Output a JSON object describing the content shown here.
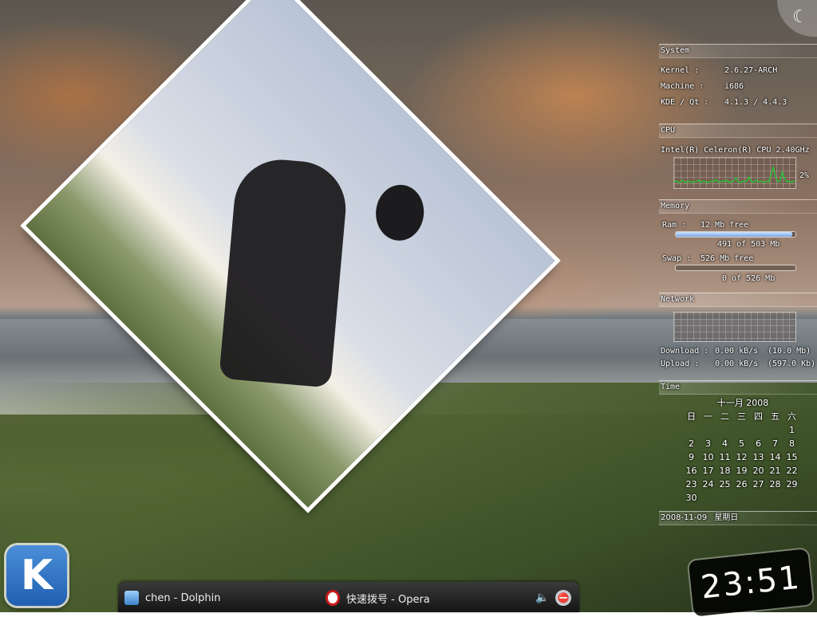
{
  "desktop": {
    "wallpaper": "beach-dunes-sunset"
  },
  "cashew": {
    "icon": "plasma-cashew"
  },
  "kde_menu": {
    "label": "K"
  },
  "taskbar": {
    "tasks": [
      {
        "label": "chen - Dolphin",
        "icon": "dolphin-file-manager-icon"
      },
      {
        "label": "快速拨号 - Opera",
        "icon": "opera-icon"
      }
    ],
    "tray": {
      "volume_icon": "🔈",
      "network_icon": "⛔"
    }
  },
  "clock": {
    "time": "23:51"
  },
  "system_monitor": {
    "system": {
      "title": "System",
      "kernel_label": "Kernel :",
      "kernel": "2.6.27-ARCH",
      "machine_label": "Machine :",
      "machine": "i686",
      "kde_label": "KDE / Qt :",
      "kde": "4.1.3 / 4.4.3"
    },
    "cpu": {
      "title": "CPU",
      "model": "Intel(R) Celeron(R) CPU 2.40GHz",
      "usage": "2%",
      "usage_value": 0.02,
      "color": "#22cc33"
    },
    "memory": {
      "title": "Memory",
      "ram_label": "Ram :",
      "ram_free": "12 Mb free",
      "ram_used_text": "491 of 503 Mb",
      "ram_fraction": 0.976,
      "swap_label": "Swap :",
      "swap_free": "526 Mb free",
      "swap_used_text": "0 of 526 Mb",
      "swap_fraction": 0
    },
    "network": {
      "title": "Network",
      "download_label": "Download :",
      "download": "0.00 kB/s",
      "download_total": "(10.0 Mb)",
      "upload_label": "Upload :",
      "upload": "0.00 kB/s",
      "upload_total": "(597.0 Kb)"
    },
    "time": {
      "title": "Time",
      "month": "十一月 2008",
      "weekdays": [
        "日",
        "一",
        "二",
        "三",
        "四",
        "五",
        "六"
      ],
      "days": [
        "",
        "",
        "",
        "",
        "",
        "",
        "1",
        "2",
        "3",
        "4",
        "5",
        "6",
        "7",
        "8",
        "9",
        "10",
        "11",
        "12",
        "13",
        "14",
        "15",
        "16",
        "17",
        "18",
        "19",
        "20",
        "21",
        "22",
        "23",
        "24",
        "25",
        "26",
        "27",
        "28",
        "29",
        "30"
      ],
      "date": "2008-11-09",
      "weekday": "星期日"
    }
  }
}
